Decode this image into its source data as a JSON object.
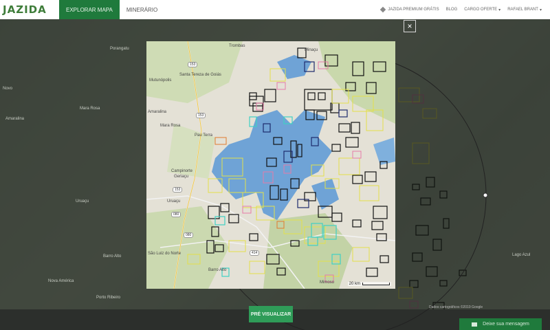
{
  "navbar": {
    "logo": "JAZIDA",
    "tabs": [
      {
        "label": "EXPLORAR MAPA",
        "active": true
      },
      {
        "label": "MINERÁRIO",
        "active": false
      }
    ],
    "premium_label": "JAZIDA PREMIUM GRÁTIS",
    "blog_label": "BLOG",
    "cards_label": "CARGO OFERTE",
    "user_label": "RAFAEL BRANT"
  },
  "background_labels": [
    "Novo",
    "Mara Rosa",
    "Amaralina",
    "Porangatu",
    "Uruaçu",
    "Barro Alto",
    "Nova América",
    "Lago Azul",
    "Porto Ribeiro"
  ],
  "map": {
    "labels": {
      "trombas": "Trombas",
      "minacu": "Minaçu",
      "santa_tereza": "Santa Tereza de Goiás",
      "mutunopolis": "Mutunópolis",
      "amaralina": "Amaralina",
      "mara_rosa": "Mara Rosa",
      "pau_terra": "Pau Terra",
      "campinorte": "Campinorte",
      "geriacu": "Geriaçu",
      "uruacu": "Uruaçu",
      "sao_luiz": "São Luiz do Norte",
      "barro_alto": "Barro Alto",
      "mimoso": "Mimoso"
    },
    "road_badges": [
      "153",
      "153",
      "153",
      "080",
      "080",
      "414"
    ],
    "scale_label": "20 km",
    "colors": {
      "water": "#6fa3d6",
      "terrain": "#dcd7c8",
      "green": "#c6d9a8",
      "claim_black": "#111111",
      "claim_yellow": "#e3e04a",
      "claim_pink": "#e67ba8",
      "claim_cyan": "#3fd0c4",
      "claim_navy": "#1d2a6b",
      "circle": "#333333"
    }
  },
  "close_icon": "×",
  "preview_button_label": "PRÉ VISUALIZAR",
  "chat_button_label": "Deixe sua mensagem",
  "attribution": "Dados cartográficos ©2019 Google"
}
